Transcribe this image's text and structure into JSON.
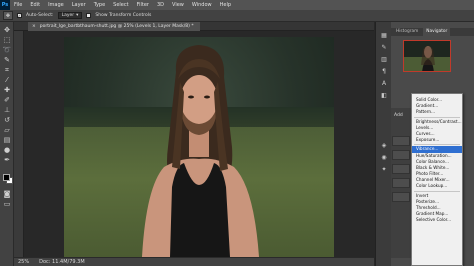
{
  "app": {
    "logo": "Ps"
  },
  "menubar": {
    "items": [
      "File",
      "Edit",
      "Image",
      "Layer",
      "Type",
      "Select",
      "Filter",
      "3D",
      "View",
      "Window",
      "Help"
    ]
  },
  "options": {
    "auto_select_label": "Auto-Select:",
    "auto_select_value": "Layer",
    "transform_label": "Show Transform Controls"
  },
  "document": {
    "tab_title": "portrait_lge_bartbthaum-shutt.jpg @ 25% (Levels 1, Layer Mask/8) *",
    "close": "×"
  },
  "status": {
    "zoom": "25%",
    "doc_info": "Doc: 11.4M/79.3M"
  },
  "panels": {
    "tabs": [
      "Histogram",
      "Navigator"
    ],
    "active_tab": "Navigator"
  },
  "adjust_menu": {
    "items": [
      {
        "label": "Solid Color...",
        "sep_after": false
      },
      {
        "label": "Gradient...",
        "sep_after": false
      },
      {
        "label": "Pattern...",
        "sep_after": true
      },
      {
        "label": "Brightness/Contrast...",
        "sep_after": false
      },
      {
        "label": "Levels...",
        "sep_after": false
      },
      {
        "label": "Curves...",
        "sep_after": false
      },
      {
        "label": "Exposure...",
        "sep_after": true
      },
      {
        "label": "Vibrance...",
        "sep_after": false,
        "highlight": true
      },
      {
        "label": "Hue/Saturation...",
        "sep_after": false
      },
      {
        "label": "Color Balance...",
        "sep_after": false
      },
      {
        "label": "Black & White...",
        "sep_after": false
      },
      {
        "label": "Photo Filter...",
        "sep_after": false
      },
      {
        "label": "Channel Mixer...",
        "sep_after": false
      },
      {
        "label": "Color Lookup...",
        "sep_after": true
      },
      {
        "label": "Invert",
        "sep_after": false
      },
      {
        "label": "Posterize...",
        "sep_after": false
      },
      {
        "label": "Threshold...",
        "sep_after": false
      },
      {
        "label": "Gradient Map...",
        "sep_after": false
      },
      {
        "label": "Selective Color...",
        "sep_after": false
      }
    ]
  },
  "layers": {
    "add_label": "Add"
  },
  "colors": {
    "foreground": "#000000",
    "background": "#ffffff",
    "highlight": "#2f6fd1"
  }
}
